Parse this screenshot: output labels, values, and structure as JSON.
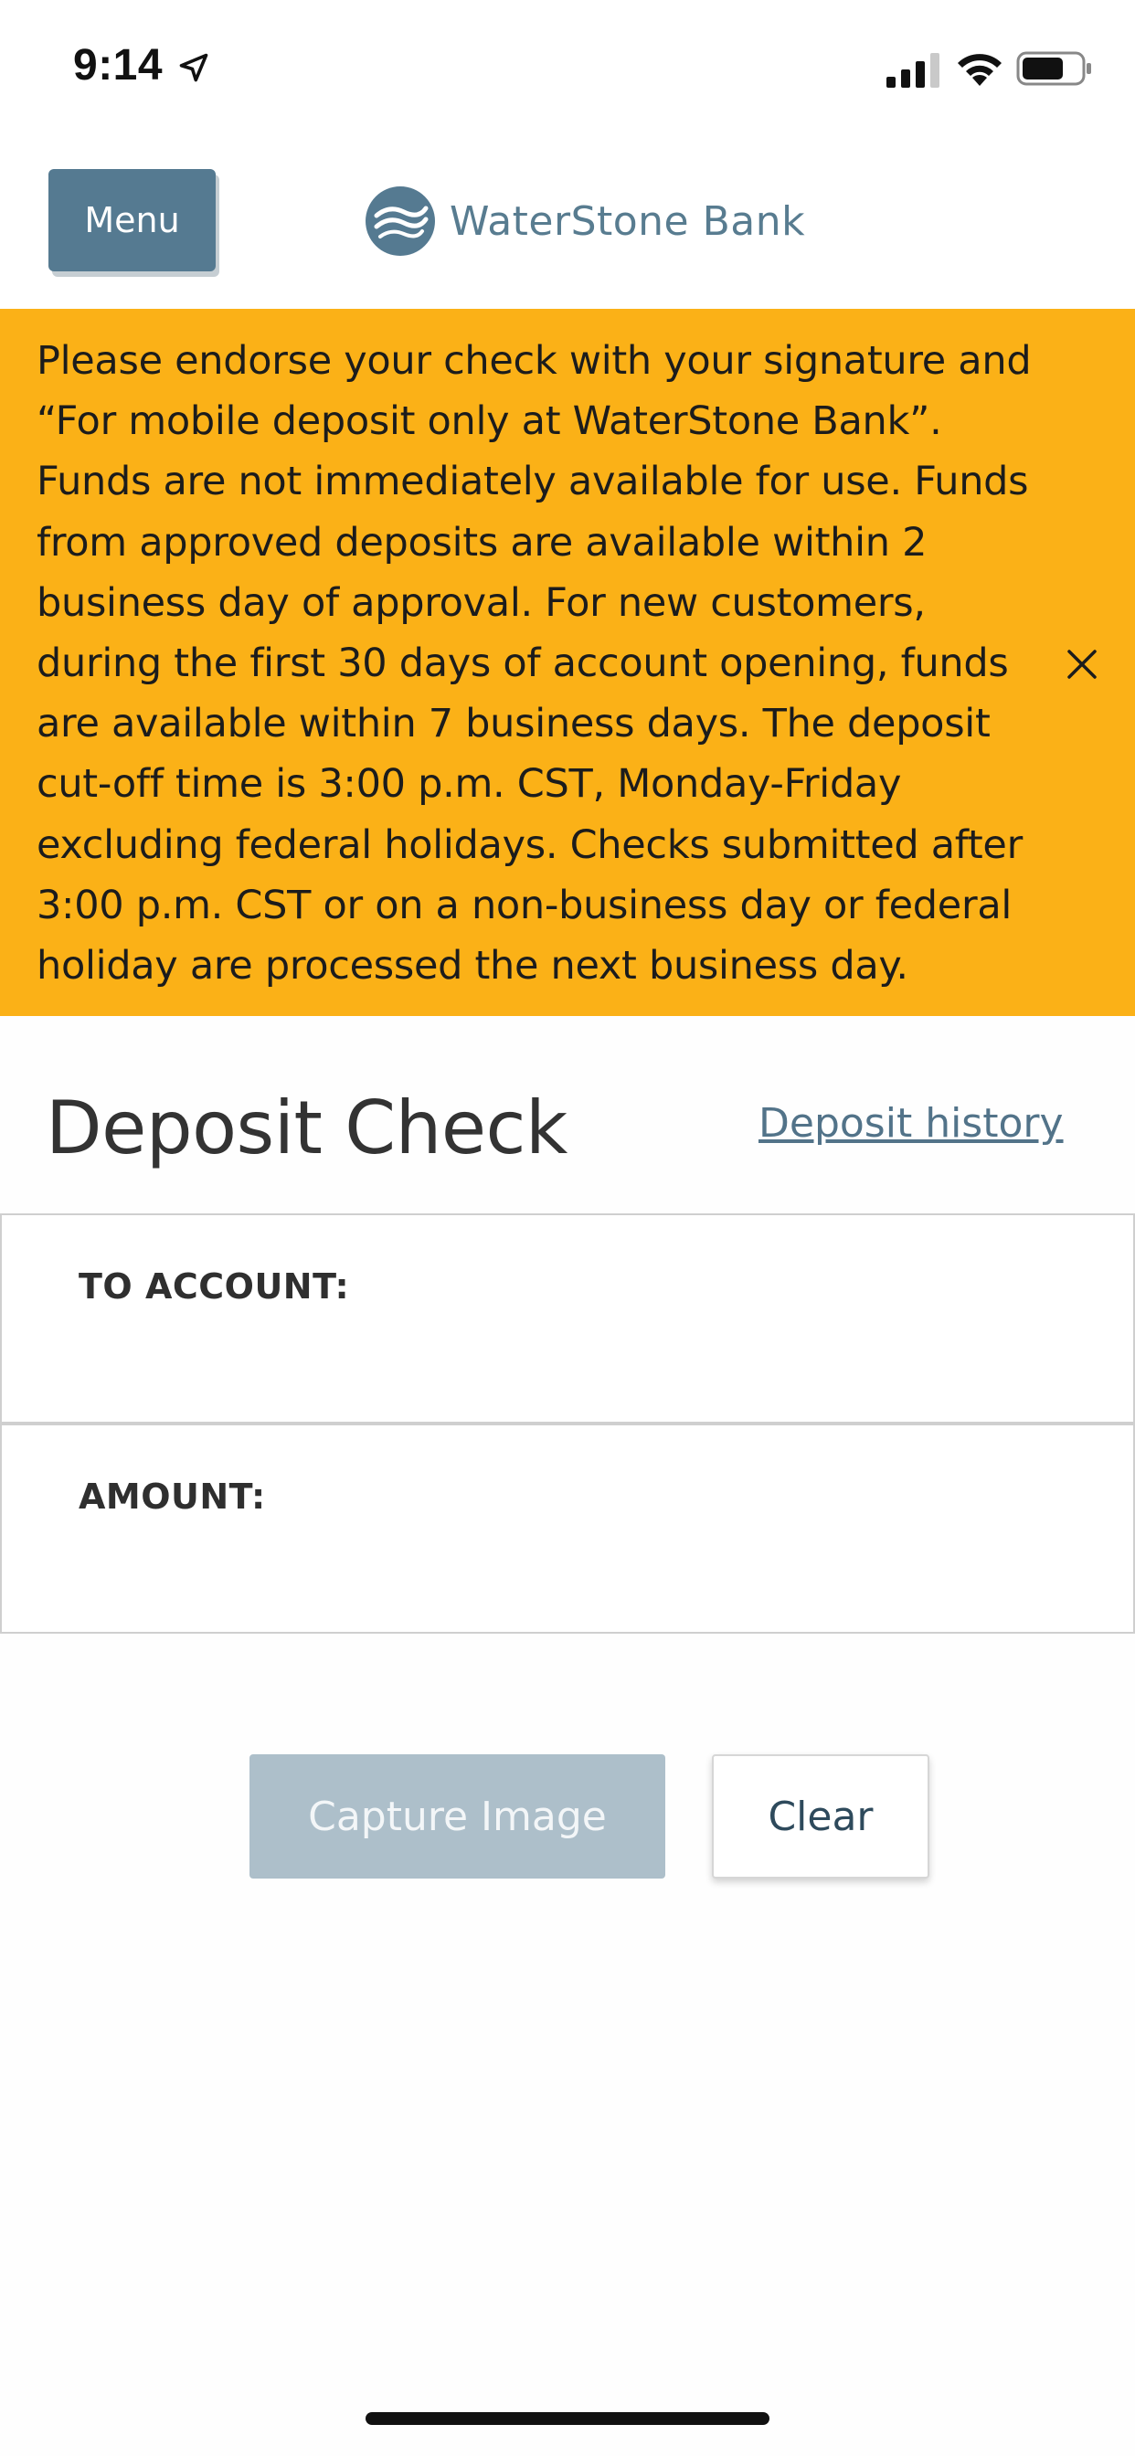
{
  "status_bar": {
    "time": "9:14"
  },
  "header": {
    "menu_label": "Menu",
    "brand_name": "WaterStone Bank"
  },
  "notice": {
    "text": "Please endorse your check with your signature and “For mobile deposit only at WaterStone Bank”. Funds are not immediately available for use. Funds from approved deposits are available within 2 business day of approval. For new customers, during the first 30 days of account opening, funds are available within 7 business days. The deposit cut-off time is 3:00 p.m. CST, Monday-Friday excluding federal holidays. Checks submitted after 3:00 p.m. CST or on a non-business day or federal holiday are processed the next business day.",
    "close_icon": "close-icon"
  },
  "deposit": {
    "title": "Deposit Check",
    "history_link": "Deposit history",
    "to_account_label": "TO ACCOUNT:",
    "amount_label": "AMOUNT:",
    "capture_label": "Capture Image",
    "clear_label": "Clear"
  },
  "colors": {
    "banner": "#fbb117",
    "menu_button": "#557a91",
    "brand_text": "#587c90",
    "capture_button_disabled": "#adbfca",
    "link": "#527389"
  }
}
